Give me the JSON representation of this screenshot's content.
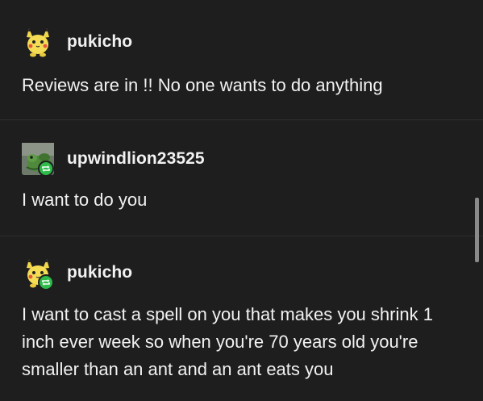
{
  "thread": {
    "posts": [
      {
        "username": "pukicho",
        "avatar_icon": "pikachu-plush-icon",
        "reblogged": false,
        "text": "Reviews are in !! No one wants to do anything"
      },
      {
        "username": "upwindlion23525",
        "avatar_icon": "frog-avatar-icon",
        "reblogged": true,
        "text": "I want to do you"
      },
      {
        "username": "pukicho",
        "avatar_icon": "pikachu-plush-icon",
        "reblogged": true,
        "text": "I want to cast a spell on you that makes you shrink 1 inch ever week so when you're 70 years old you're smaller than an ant and an ant eats you"
      }
    ]
  },
  "colors": {
    "background": "#1e1e1e",
    "text": "#f2f2f2",
    "reblog_badge": "#2ebb4a"
  }
}
